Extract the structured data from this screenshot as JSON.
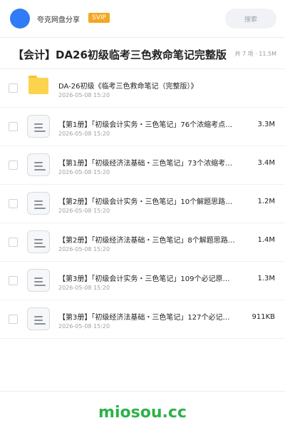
{
  "header": {
    "username": "夸克网盘分享",
    "vip_badge": "SVIP",
    "search_placeholder": "搜索"
  },
  "folder": {
    "title": "【会计】DA26初级临考三色救命笔记完整版",
    "meta": "共 7 项 · 11.5M"
  },
  "files": [
    {
      "name": "DA-26初级《临考三色救命笔记（完整版）》",
      "date": "2026-05-08 15:20",
      "size": "",
      "icon": "folder-icon"
    },
    {
      "name": "【第1册】「初级会计实务・三色笔记」76个浓缩考点…",
      "date": "2026-05-08 15:20",
      "size": "3.3M",
      "icon": "document-icon"
    },
    {
      "name": "【第1册】「初级经济法基础・三色笔记」73个浓缩考…",
      "date": "2026-05-08 15:20",
      "size": "3.4M",
      "icon": "document-icon"
    },
    {
      "name": "【第2册】「初级会计实务・三色笔记」10个解题思路…",
      "date": "2026-05-08 15:20",
      "size": "1.2M",
      "icon": "document-icon"
    },
    {
      "name": "【第2册】「初级经济法基础・三色笔记」8个解题思路…",
      "date": "2026-05-08 15:20",
      "size": "1.4M",
      "icon": "document-icon"
    },
    {
      "name": "【第3册】「初级会计实务・三色笔记」109个必记原…",
      "date": "2026-05-08 15:20",
      "size": "1.3M",
      "icon": "document-icon"
    },
    {
      "name": "【第3册】「初级经济法基础・三色笔记」127个必记…",
      "date": "2026-05-08 15:20",
      "size": "911KB",
      "icon": "document-icon"
    }
  ],
  "footer": {
    "brand": "miosou.cc"
  },
  "colors": {
    "avatar": "#2f7cf6",
    "vip": "#f5a623",
    "brand": "#2db24a",
    "folder": "#fcd34d"
  }
}
